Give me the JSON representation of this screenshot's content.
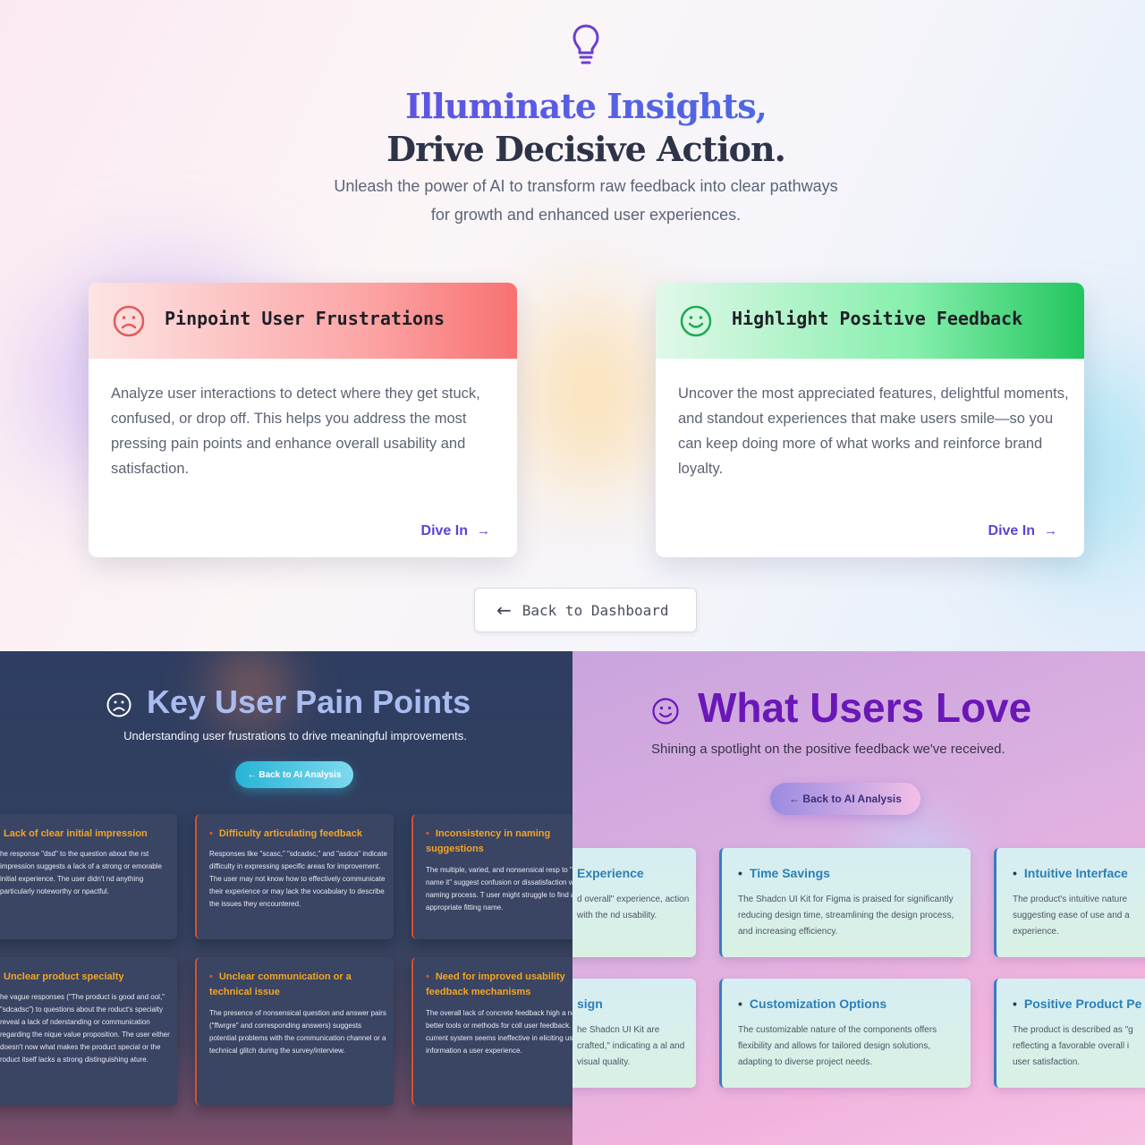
{
  "top": {
    "title_line1": "Illuminate Insights,",
    "title_line2": "Drive Decisive Action.",
    "subtitle": "Unleash the power of AI to transform raw feedback into clear pathways for growth and enhanced user experiences.",
    "cards": [
      {
        "title": "Pinpoint User Frustrations",
        "body": "Analyze user interactions to detect where they get stuck, confused, or drop off. This helps you address the most pressing pain points and enhance overall usability and satisfaction.",
        "link": "Dive In",
        "icon": "frown-icon",
        "accent": "#f87171"
      },
      {
        "title": "Highlight Positive Feedback",
        "body": "Uncover the most appreciated features, delightful moments, and standout experiences that make users smile—so you can keep doing more of what works and reinforce brand loyalty.",
        "link": "Dive In",
        "icon": "smile-icon",
        "accent": "#22c55e"
      }
    ],
    "back_button": "Back to Dashboard"
  },
  "pain": {
    "title": "Key User Pain Points",
    "subtitle": "Understanding user frustrations to drive meaningful improvements.",
    "back_button": "← Back to AI Analysis",
    "items": [
      {
        "title": "Lack of clear initial impression",
        "body": "he response \"dsd\" to the question about the rst impression suggests a lack of a strong or emorable initial experience. The user didn't nd anything particularly noteworthy or npactful."
      },
      {
        "title": "Difficulty articulating feedback",
        "body": "Responses like \"scasc,\" \"sdcadsc,\" and \"asdca\" indicate difficulty in expressing specific areas for improvement. The user may not know how to effectively communicate their experience or may lack the vocabulary to describe the issues they encountered."
      },
      {
        "title": "Inconsistency in naming suggestions",
        "body": "The multiple, varied, and nonsensical resp to \"Hey, name it\" suggest confusion or dissatisfaction with the naming process. T user might struggle to find an appropriate fitting name."
      },
      {
        "title": "Unclear product specialty",
        "body": "he vague responses (\"The product is good and ool,\" \"sdcadsc\") to questions about the roduct's specialty reveal a lack of nderstanding or communication regarding the nique value proposition. The user either doesn't now what makes the product special or the roduct itself lacks a strong distinguishing ature."
      },
      {
        "title": "Unclear communication or a technical issue",
        "body": "The presence of nonsensical question and answer pairs (\"ffwrgre\" and corresponding answers) suggests potential problems with the communication channel or a technical glitch during the survey/interview."
      },
      {
        "title": "Need for improved usability feedback mechanisms",
        "body": "The overall lack of concrete feedback high a need for better tools or methods for coll user feedback. The current system seems ineffective in eliciting useful information a user experience."
      }
    ]
  },
  "love": {
    "title": "What Users Love",
    "subtitle": "Shining a spotlight on the positive feedback we've received.",
    "back_button": "← Back to AI Analysis",
    "items": [
      {
        "title": "Experience",
        "body": "d overall\" experience, action with the nd usability."
      },
      {
        "title": "Time Savings",
        "body": "The Shadcn UI Kit for Figma is praised for significantly reducing design time, streamlining the design process, and increasing efficiency."
      },
      {
        "title": "Intuitive Interface",
        "body": "The product's intuitive nature suggesting ease of use and a experience."
      },
      {
        "title": "sign",
        "body": "he Shadcn UI Kit are crafted,\" indicating a al and visual quality."
      },
      {
        "title": "Customization Options",
        "body": "The customizable nature of the components offers flexibility and allows for tailored design solutions, adapting to diverse project needs."
      },
      {
        "title": "Positive Product Pe",
        "body": "The product is described as \"g reflecting a favorable overall i user satisfaction."
      }
    ]
  }
}
